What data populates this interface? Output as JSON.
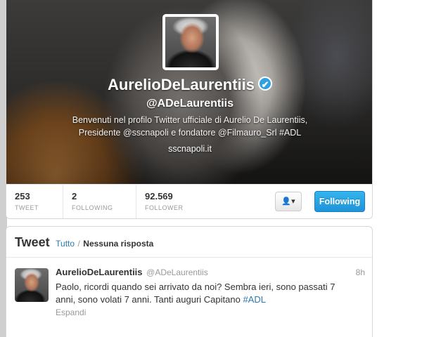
{
  "profile": {
    "display_name": "AurelioDeLaurentiis",
    "verified_glyph": "✔",
    "screen_name": "@ADeLaurentiis",
    "bio_line1": "Benvenuti nel profilo Twitter ufficiale di Aurelio De Laurentiis,",
    "bio_line2": "Presidente @sscnapoli e fondatore @Filmauro_Srl #ADL",
    "website": "sscnapoli.it",
    "stats": {
      "tweets_count": "253",
      "tweets_label": "TWEET",
      "following_count": "2",
      "following_label": "FOLLOWING",
      "followers_count": "92.569",
      "followers_label": "FOLLOWER"
    },
    "user_dropdown_glyph": "👤▾",
    "follow_button_label": "Following"
  },
  "timeline": {
    "title": "Tweet",
    "tab_all": "Tutto",
    "tab_separator": "/",
    "tab_no_replies": "Nessuna risposta",
    "tweets": [
      {
        "author": "AurelioDeLaurentiis",
        "handle": "@ADeLaurentiis",
        "time": "8h",
        "text": "Paolo, ricordi quando sei arrivato da noi? Sembra ieri, sono passati 7 anni, sono volati 7 anni. Tanti auguri Capitano ",
        "hashtag": "#ADL",
        "expand": "Espandi"
      }
    ]
  },
  "colors": {
    "accent_blue": "#2a7ab0",
    "follow_button": "#1f93d9",
    "verified": "#2fa0e0"
  },
  "icons": {
    "verified": "verified-check-icon",
    "user_menu": "user-dropdown-icon"
  }
}
